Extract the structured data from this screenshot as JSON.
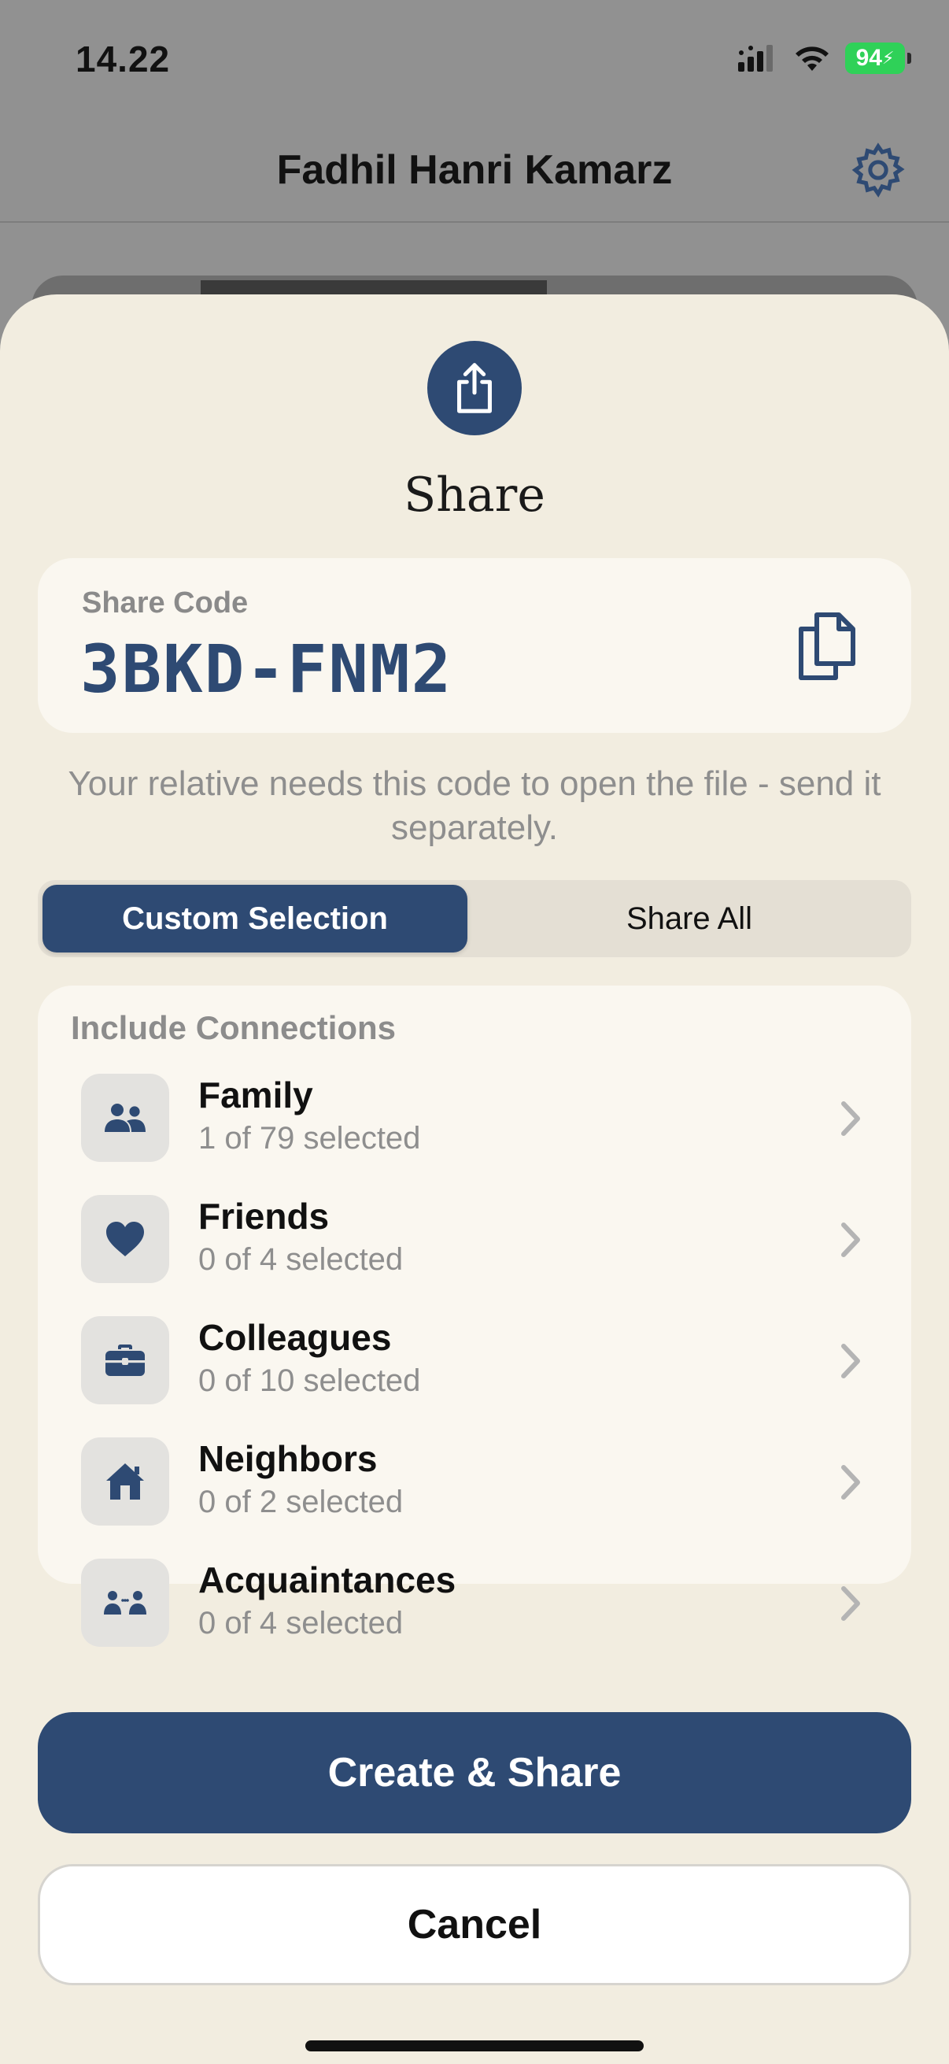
{
  "status_bar": {
    "time": "14.22",
    "battery": "94"
  },
  "background": {
    "title": "Fadhil Hanri Kamarz"
  },
  "sheet": {
    "title": "Share",
    "share_code": {
      "label": "Share Code",
      "value": "3BKD-FNM2"
    },
    "note": "Your relative needs this code to open the file - send it separately.",
    "segments": {
      "active": "Custom Selection",
      "inactive": "Share All"
    },
    "connections": {
      "header": "Include Connections",
      "items": [
        {
          "name": "Family",
          "selected": "1 of 79 selected",
          "icon": "family-icon"
        },
        {
          "name": "Friends",
          "selected": "0 of 4 selected",
          "icon": "heart-icon"
        },
        {
          "name": "Colleagues",
          "selected": "0 of 10 selected",
          "icon": "briefcase-icon"
        },
        {
          "name": "Neighbors",
          "selected": "0 of 2 selected",
          "icon": "house-icon"
        },
        {
          "name": "Acquaintances",
          "selected": "0 of 4 selected",
          "icon": "acquaintances-icon"
        }
      ]
    },
    "primary_button": "Create & Share",
    "secondary_button": "Cancel"
  },
  "colors": {
    "accent": "#2e4a73",
    "sheet_bg": "#f2ede0",
    "card_bg": "#faf7f0",
    "battery": "#2fd158"
  }
}
